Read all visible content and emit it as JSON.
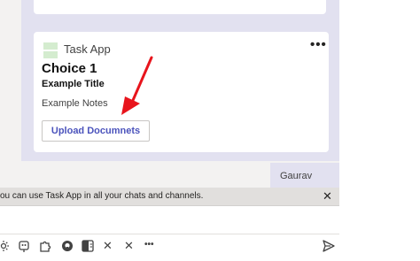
{
  "card": {
    "app_name": "Task App",
    "more": "•••",
    "choice": "Choice 1",
    "title": "Example Title",
    "notes": "Example Notes",
    "upload_button": "Upload Documnets"
  },
  "sender_name": "Gaurav",
  "notice": {
    "text": "ou can use Task App in all your chats and channels.",
    "close": "✕"
  },
  "toolbar": {
    "icons": [
      "sun-icon",
      "bot-icon",
      "puzzle-icon",
      "github-icon",
      "onenote-icon",
      "x-icon",
      "x-icon",
      "more-icon",
      "send-icon"
    ],
    "x1": "✕",
    "x2": "✕",
    "more": "•••"
  },
  "colors": {
    "bubble": "#e2e1f0",
    "accent": "#4b53bc",
    "arrow": "#e8141c"
  }
}
